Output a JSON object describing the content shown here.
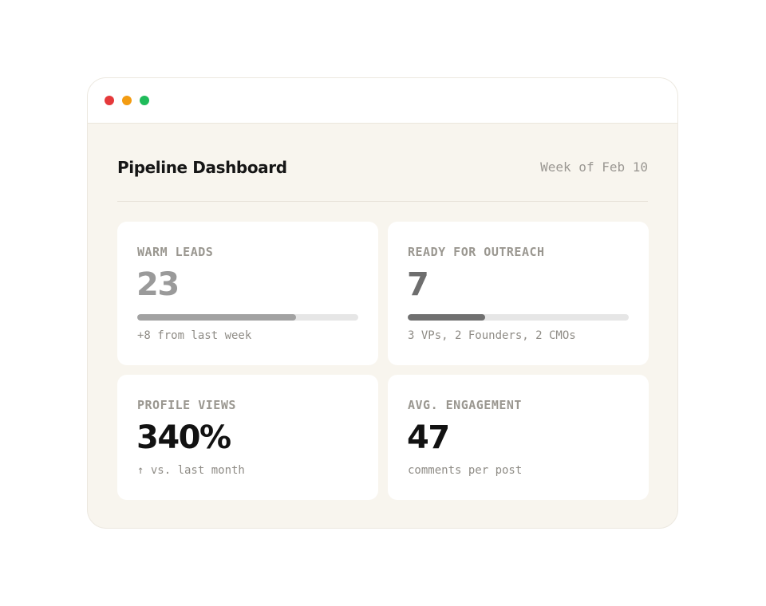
{
  "window": {
    "controls": {
      "close_color": "#e5393b",
      "minimize_color": "#f39c12",
      "maximize_color": "#1fbb5a"
    }
  },
  "header": {
    "title": "Pipeline Dashboard",
    "date_label": "Week of Feb 10"
  },
  "cards": [
    {
      "label": "WARM LEADS",
      "value": "23",
      "progress": 0.72,
      "bar_color": "#a2a2a2",
      "subtitle": "+8 from last week"
    },
    {
      "label": "READY FOR OUTREACH",
      "value": "7",
      "progress": 0.35,
      "bar_color": "#707070",
      "subtitle": "3 VPs, 2 Founders, 2 CMOs"
    },
    {
      "label": "PROFILE VIEWS",
      "value": "340%",
      "subtitle": "↑ vs. last month"
    },
    {
      "label": "AVG. ENGAGEMENT",
      "value": "47",
      "subtitle": "comments per post"
    }
  ]
}
